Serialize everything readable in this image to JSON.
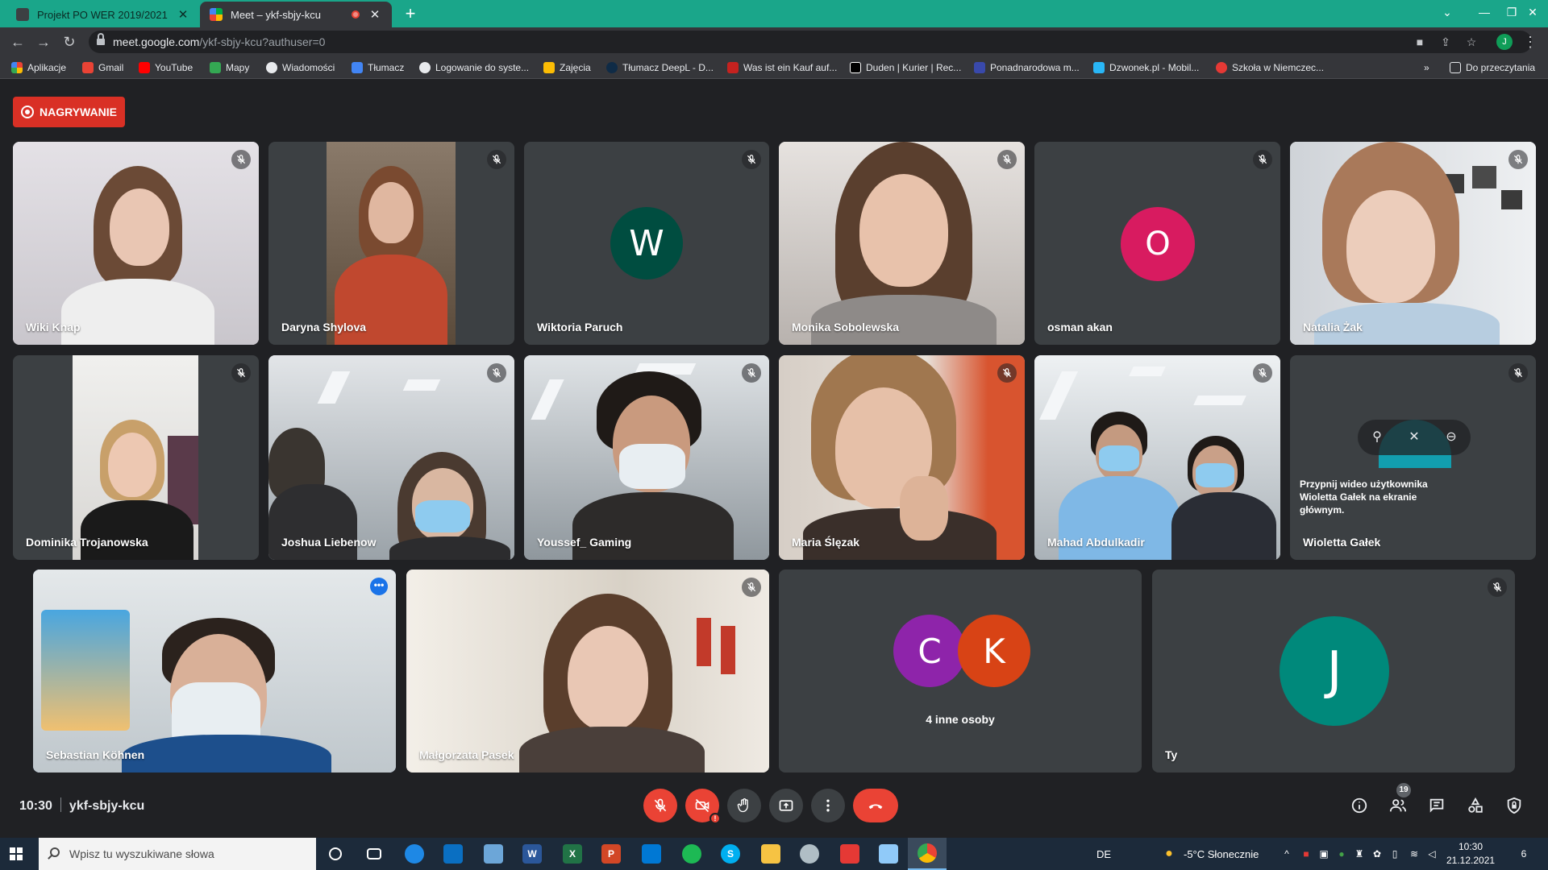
{
  "browser": {
    "tabs": [
      {
        "title": "Projekt PO WER 2019/2021",
        "close": "✕"
      },
      {
        "title": "Meet – ykf-sbjy-kcu",
        "close": "✕"
      }
    ],
    "new_tab": "+",
    "window_controls": {
      "minimize": "—",
      "maximize": "❐",
      "close": "✕"
    },
    "url_host": "meet.google.com",
    "url_path": "/ykf-sbjy-kcu?authuser=0",
    "profile_initial": "J",
    "bookmarks": [
      "Aplikacje",
      "Gmail",
      "YouTube",
      "Mapy",
      "Wiadomości",
      "Tłumacz",
      "Logowanie do syste...",
      "Zajęcia",
      "Tłumacz DeepL - D...",
      "Was ist ein Kauf auf...",
      "Duden | Kurier | Rec...",
      "Ponadnarodowa m...",
      "Dzwonek.pl - Mobil...",
      "Szkoła w Niemczec..."
    ],
    "bookmarks_more": "»",
    "reading_list": "Do przeczytania"
  },
  "meet": {
    "recording_label": "NAGRYWANIE",
    "participants": [
      "Wiki Knap",
      "Daryna Shylova",
      "Wiktoria Paruch",
      "Monika Sobolewska",
      "osman akan",
      "Natalia Żak",
      "Dominika Trojanowska",
      "Joshua Liebenow",
      "Youssef_ Gaming",
      "Maria Ślęzak",
      "Mahad Abdulkadir",
      "Wioletta Gałek",
      "Sebastian Köhnen",
      "Małgorzata Pasek"
    ],
    "avatar_letters": {
      "wiktoria": "W",
      "osman": "O",
      "group_1": "C",
      "group_2": "K",
      "self": "J"
    },
    "colors": {
      "wiktoria": "#004d40",
      "osman": "#d81b60",
      "group_1": "#8e24aa",
      "group_2": "#d84315",
      "self": "#00897b",
      "recording": "#d93025",
      "active_outline": "#8ab4f8"
    },
    "pin_hint": "Przypnij wideo użytkownika Wioletta Gałek na ekranie głównym.",
    "others_label": "4 inne osoby",
    "self_label": "Ty",
    "time": "10:30",
    "meeting_code": "ykf-sbjy-kcu",
    "participants_count": "19",
    "camera_alert": "!"
  },
  "taskbar": {
    "search_placeholder": "Wpisz tu wyszukiwane słowa",
    "language": "DE",
    "weather": "-5°C  Słonecznie",
    "time": "10:30",
    "date": "21.12.2021",
    "notifications": "6"
  }
}
